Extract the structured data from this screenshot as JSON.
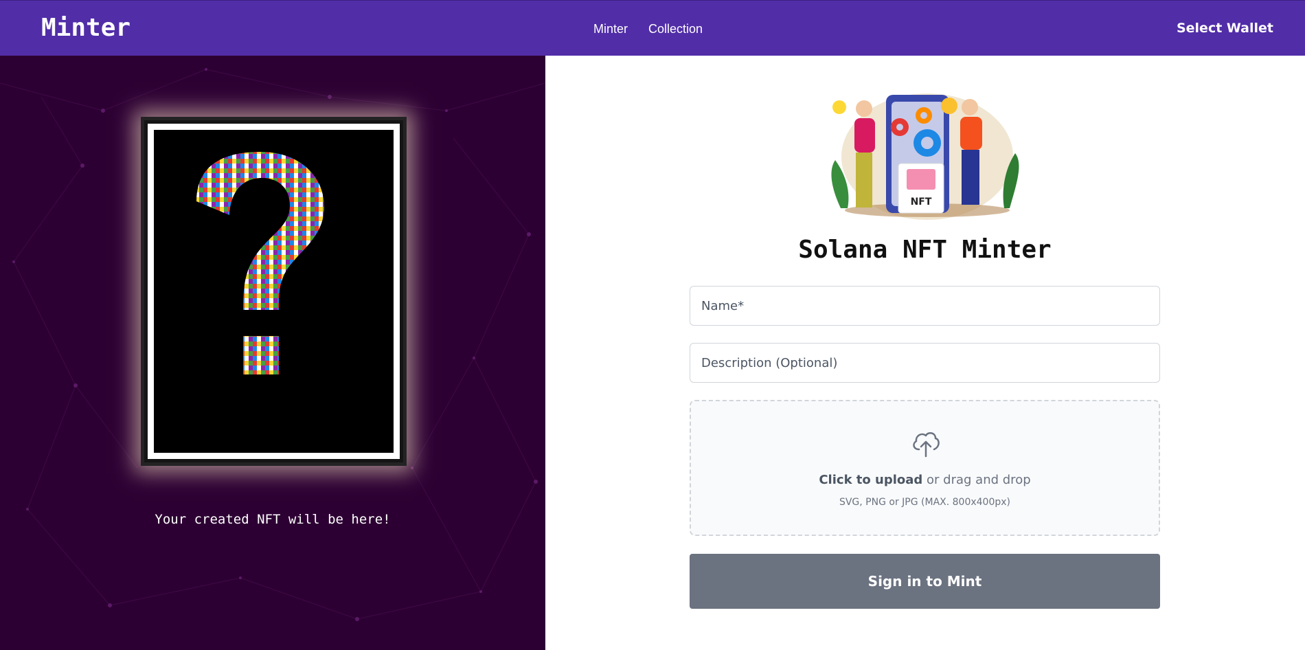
{
  "navbar": {
    "brand": "Minter",
    "links": [
      "Minter",
      "Collection"
    ],
    "wallet_label": "Select Wallet",
    "background": "#512da8"
  },
  "left_panel": {
    "placeholder_text": "Your created NFT will be here!",
    "background": "#2d0033"
  },
  "main": {
    "title": "Solana NFT Minter",
    "name_placeholder": "Name*",
    "description_placeholder": "Description (Optional)",
    "upload": {
      "cta": "Click to upload",
      "rest": " or drag and drop",
      "hint": "SVG, PNG or JPG (MAX. 800x400px)"
    },
    "mint_label": "Sign in to Mint",
    "illustration_badge": "NFT"
  },
  "colors": {
    "mint_button": "#6b7280",
    "input_border": "#d1d5db"
  }
}
